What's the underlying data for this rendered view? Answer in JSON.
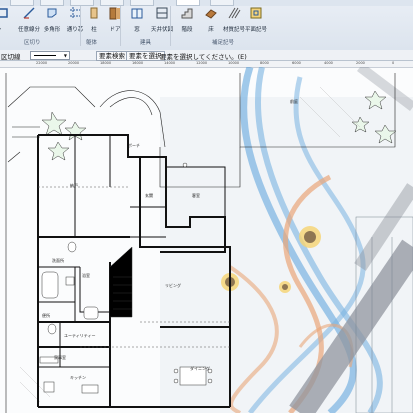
{
  "ribbon": {
    "buttons": [
      {
        "label": "シ",
        "icon": "wall-tool-icon"
      },
      {
        "label": "任意線分",
        "icon": "free-line-icon"
      },
      {
        "label": "多角形",
        "icon": "polygon-icon"
      },
      {
        "label": "通り芯",
        "icon": "grid-line-icon"
      },
      {
        "label": "柱",
        "icon": "column-icon"
      },
      {
        "label": "ドア",
        "icon": "door-icon"
      },
      {
        "label": "窓",
        "icon": "window-icon"
      },
      {
        "label": "天井伏図",
        "icon": "ceiling-plan-icon"
      },
      {
        "label": "階段",
        "icon": "stairs-icon"
      },
      {
        "label": "床",
        "icon": "floor-icon"
      },
      {
        "label": "材質記号",
        "icon": "material-symbol-icon"
      },
      {
        "label": "平面記号",
        "icon": "plan-symbol-icon"
      }
    ],
    "groups": [
      "区切り",
      "躯体",
      "建具",
      "補足記号"
    ]
  },
  "toolbar": {
    "layer_label": "区切線",
    "search_button": "要素検索",
    "select_button": "要素を選択",
    "status": "要素を選択してください。(E)"
  },
  "ruler": {
    "ticks": [
      "22000",
      "20000",
      "18000",
      "16000",
      "14000",
      "12000",
      "10000",
      "8000",
      "6000",
      "4000",
      "2000",
      "0"
    ]
  },
  "plan": {
    "rooms": [
      "納戸",
      "ポーチ",
      "玄関",
      "客室",
      "洗面所",
      "浴室",
      "便所",
      "ユーティリティー",
      "リビング",
      "家事室",
      "キッチン",
      "ダイニング",
      "前庭"
    ]
  },
  "colors": {
    "ribbon_bg": "#e3e9f1",
    "hose_blue": "#4f9bd9",
    "hose_orange": "#e58a4e",
    "pipe_gray": "#6e7480"
  }
}
